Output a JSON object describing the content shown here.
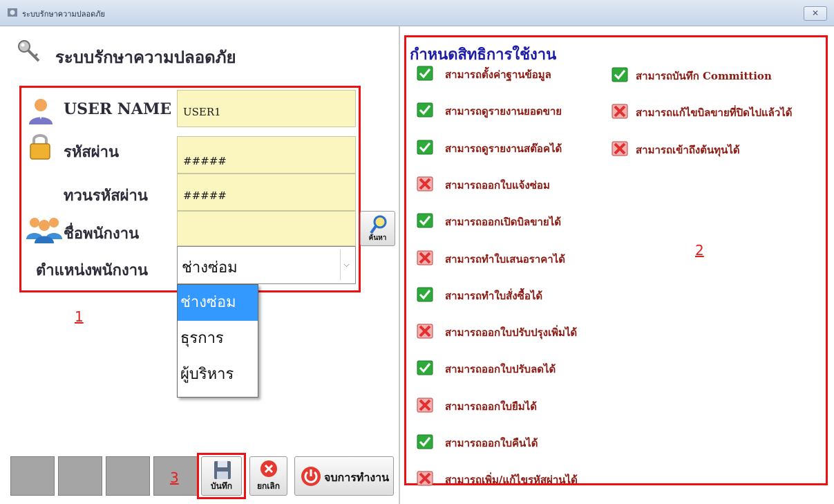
{
  "window": {
    "title": "ระบบรักษาความปลอดภัย",
    "close_symbol": "✕"
  },
  "left": {
    "heading": "ระบบรักษาความปลอดภัย",
    "fields": {
      "username": {
        "label": "USER NAME",
        "value": "USER1"
      },
      "password": {
        "label": "รหัสผ่าน",
        "value": "#####"
      },
      "confirm": {
        "label": "ทวนรหัสผ่าน",
        "value": "#####"
      },
      "employee": {
        "label": "ชื่อพนักงาน",
        "value": ""
      },
      "position": {
        "label": "ตำแหน่งพนักงาน",
        "value": "ช่างซ่อม"
      }
    },
    "search_button": "ค้นหา",
    "dropdown_options": [
      "ช่างซ่อม",
      "ธุรการ",
      "ผู้บริหาร"
    ],
    "markers": {
      "m1": "1",
      "m3": "3"
    },
    "buttons": {
      "save": "บันทึก",
      "cancel": "ยกเลิก",
      "exit": "จบการทำงาน"
    }
  },
  "right": {
    "title": "กำหนดสิทธิการใช้งาน",
    "marker": "2",
    "permissions_col1": [
      {
        "label": "สามารถตั้งค่าฐานข้อมูล",
        "granted": true
      },
      {
        "label": "สามารถดูรายงานยอดขาย",
        "granted": true
      },
      {
        "label": "สามารถดูรายงานสต๊อคได้",
        "granted": true
      },
      {
        "label": "สามารถออกใบแจ้งซ่อม",
        "granted": false
      },
      {
        "label": "สามารถออกเปิดบิลขายได้",
        "granted": true
      },
      {
        "label": "สามารถทำใบเสนอราคาได้",
        "granted": false
      },
      {
        "label": "สามารถทำใบสั่งซื้อได้",
        "granted": true
      },
      {
        "label": "สามารถออกใบปรับปรุงเพิ่มได้",
        "granted": false
      },
      {
        "label": "สามารถออกใบปรับลดได้",
        "granted": true
      },
      {
        "label": "สามารถออกใบยืมได้",
        "granted": false
      },
      {
        "label": "สามารถออกใบคืนได้",
        "granted": true
      },
      {
        "label": "สามารถเพิ่ม/แก้ไขรหัสผ่านได้",
        "granted": false
      }
    ],
    "permissions_col2": [
      {
        "label": "สามารถบันทึก Committion",
        "granted": true
      },
      {
        "label": "สามารถแก้ไขบิลขายที่ปิดไปแล้วได้",
        "granted": false
      },
      {
        "label": "สามารถเข้าถึงต้นทุนได้",
        "granted": false
      }
    ]
  },
  "colors": {
    "granted": "#2eaa3a",
    "denied": "#e03030",
    "highlight": "#ee1111",
    "selection": "#3399ff"
  }
}
